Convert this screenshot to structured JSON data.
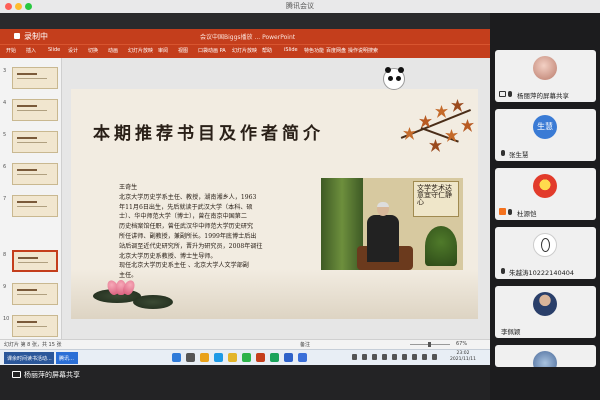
{
  "window": {
    "title": "腾讯会议"
  },
  "ppt": {
    "file_label": "录制中",
    "center_title": "会议中国Biggs播放 ... PowerPoint",
    "ribbon_tabs": [
      "开始",
      "插入",
      "Slide",
      "设计",
      "切换",
      "动画",
      "幻灯片放映",
      "审阅",
      "视图",
      "口袋动画 PA",
      "幻灯片放映",
      "帮助",
      "iSlide",
      "特色功能",
      "百度网盘",
      "操作说明搜索"
    ],
    "slide_numbers": [
      "3",
      "4",
      "5",
      "6",
      "7",
      "8",
      "9",
      "10"
    ],
    "status_left": "幻灯片 第 8 张，共 15 张",
    "status_notes": "备注",
    "status_zoom": "67%"
  },
  "slide": {
    "title": "本期推荐书目及作者简介",
    "author_lines": [
      "王奇生",
      "北京大学历史学系主任、教授，湖南湘乡人，1963",
      "年11月6日出生，先后就读于武汉大学（本科、硕",
      "士）、华中师范大学（博士），曾在南京中国第二",
      "历史档案馆任职，曾任武汉华中师范大学历史研究",
      "所任讲师、副教授，兼副所长。1999年底博士后出",
      "站后调至近代史研究所，晋升为研究员，2008年调往",
      "北京大学历史系教授、博士生导师。",
      "现任北京大学历史系主任 、北京大学人文学部副",
      "主任。"
    ],
    "calligraphy": "文学艺术达意宜守仁静心"
  },
  "taskbar": {
    "app_label": "课余时间读书活动...",
    "second_app": "腾讯…",
    "time": "23:02",
    "date": "2021/11/11"
  },
  "share": {
    "label": "杨丽萍的屏幕共享"
  },
  "participants": [
    {
      "name": "杨丽萍的屏幕共享",
      "avatar_text": "",
      "kind": "screen"
    },
    {
      "name": "张生慧",
      "avatar_text": "生慧",
      "kind": "mic"
    },
    {
      "name": "杜源恺",
      "avatar_text": "",
      "kind": "user"
    },
    {
      "name": "朱越涛10222140404",
      "avatar_text": "",
      "kind": "mic"
    },
    {
      "name": "李佩颖",
      "avatar_text": "",
      "kind": "plain"
    },
    {
      "name": "",
      "avatar_text": "",
      "kind": "plain"
    }
  ],
  "colors": {
    "ppt_red": "#c43e1c",
    "gallery_bg": "#1c1c1e",
    "avatar_blue": "#3a7bd5"
  }
}
